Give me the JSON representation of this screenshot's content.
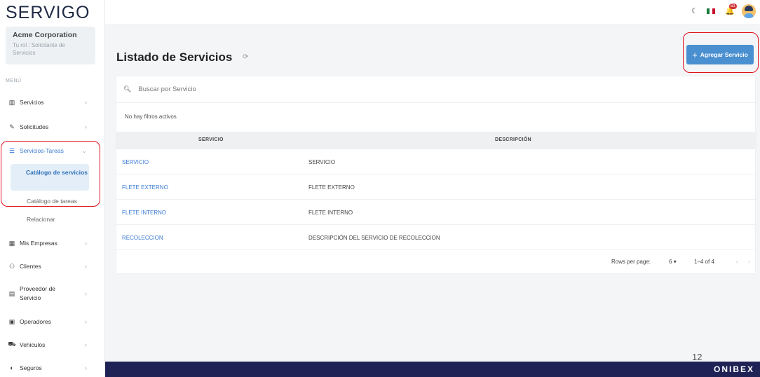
{
  "brand": {
    "logo_text": "SERVIGO"
  },
  "org": {
    "name": "Acme Corporation",
    "role": "Tu rol : Solicitante de Servicios"
  },
  "sidebar": {
    "menu_label": "MENÚ",
    "items": [
      {
        "label": "Servicios",
        "icon": "briefcase-icon"
      },
      {
        "label": "Solicitudes",
        "icon": "edit-doc-icon"
      },
      {
        "label": "Servicios-Tareas",
        "icon": "tasks-icon"
      },
      {
        "label": "Mis Empresas",
        "icon": "building-icon"
      },
      {
        "label": "Clientes",
        "icon": "users-icon"
      },
      {
        "label": "Proveedor de Servicio",
        "icon": "id-card-icon"
      },
      {
        "label": "Operadores",
        "icon": "operator-card-icon"
      },
      {
        "label": "Vehiculos",
        "icon": "truck-icon"
      },
      {
        "label": "Seguros",
        "icon": "shield-icon"
      }
    ],
    "subitems": {
      "catalogo_servicios": "Catálogo de servicios",
      "catalogo_tareas": "Catálogo de tareas",
      "relacionar": "Relacionar"
    }
  },
  "topbar": {
    "notification_count": "51"
  },
  "main": {
    "title": "Listado de Servicios",
    "add_button": "Agregar Servicio",
    "search_placeholder": "Buscar por Servicio",
    "filters_text": "No hay filtros activos",
    "columns": [
      "SERVICIO",
      "DESCRIPCIÓN"
    ],
    "rows": [
      {
        "servicio": "SERVICIO",
        "descripcion": "SERVICIO"
      },
      {
        "servicio": "FLETE EXTERNO",
        "descripcion": "FLETE EXTERNO"
      },
      {
        "servicio": "FLETE INTERNO",
        "descripcion": "FLETE INTERNO"
      },
      {
        "servicio": "RECOLECCION",
        "descripcion": "DESCRIPCIÓN DEL SERVICIO DE RECOLECCION"
      }
    ],
    "pagination": {
      "label": "Rows per page:",
      "per_page": "6",
      "range": "1–4 of 4"
    }
  },
  "footer": {
    "page_number": "12",
    "brand": "ONIBEX"
  },
  "colors": {
    "accent": "#4a8fd0",
    "link": "#3a7bd5",
    "footer": "#1e2254",
    "highlight": "#e0121b"
  }
}
